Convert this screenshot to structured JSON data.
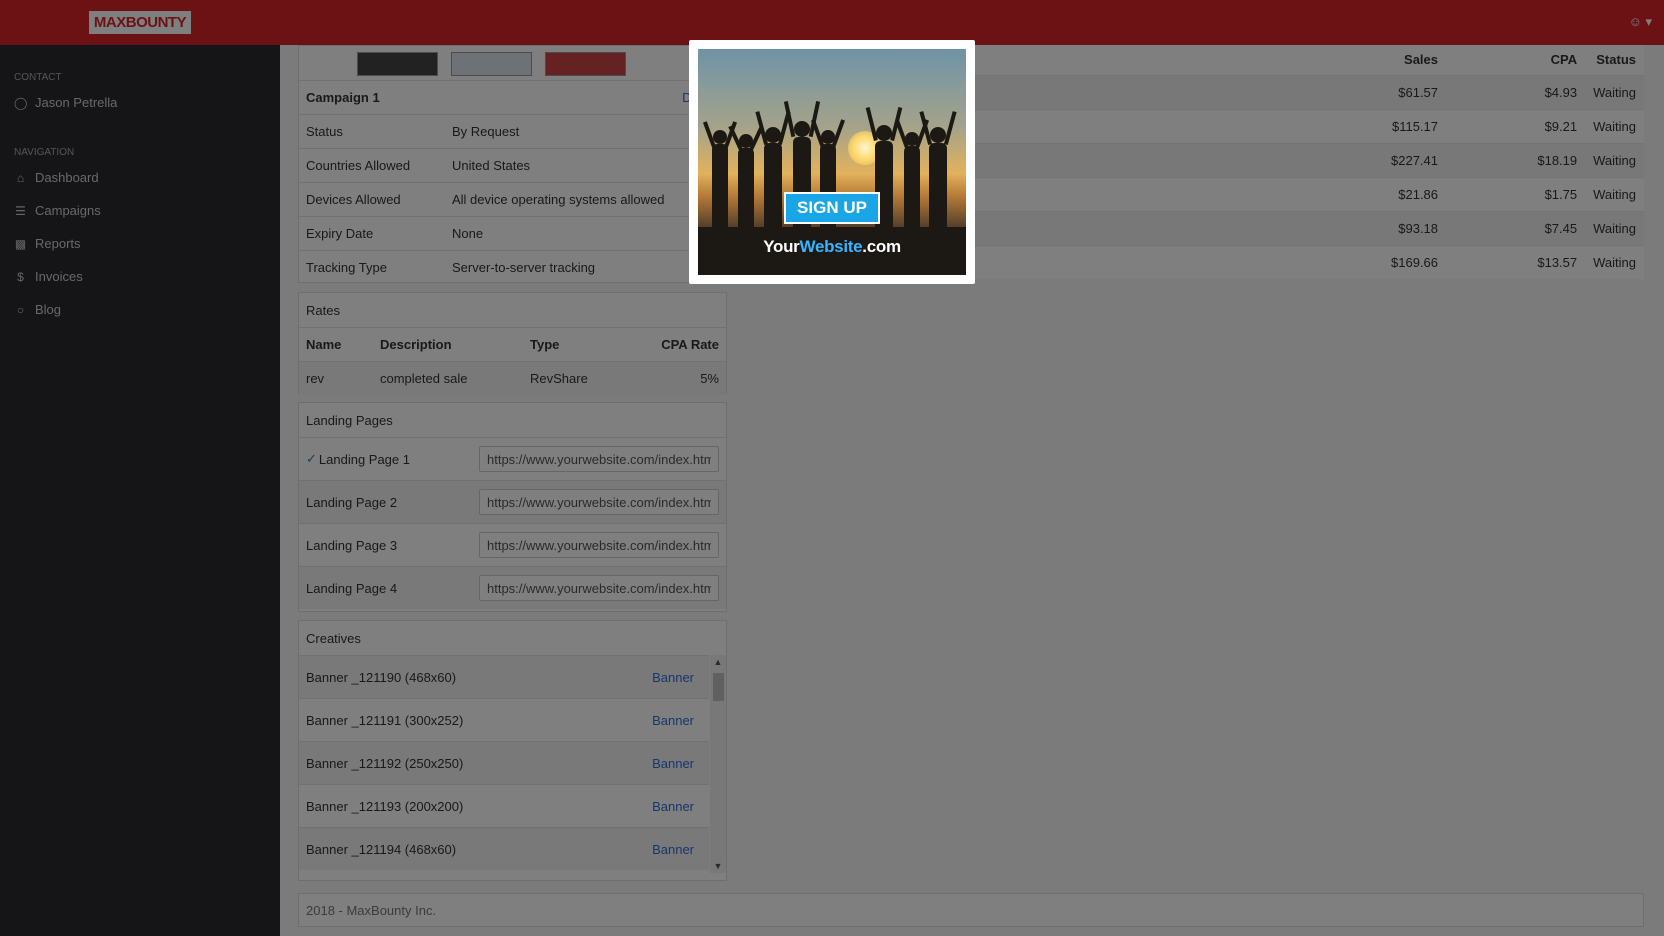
{
  "app": {
    "logo": "MAXBOUNTY"
  },
  "sidebar": {
    "contact_heading": "CONTACT",
    "contact_name": "Jason Petrella",
    "nav_heading": "NAVIGATION",
    "items": [
      {
        "label": "Dashboard",
        "icon": "home-icon"
      },
      {
        "label": "Campaigns",
        "icon": "layers-icon"
      },
      {
        "label": "Reports",
        "icon": "bar-chart-icon"
      },
      {
        "label": "Invoices",
        "icon": "dollar-icon"
      },
      {
        "label": "Blog",
        "icon": "comment-icon"
      }
    ]
  },
  "campaign": {
    "title": "Campaign 1",
    "description_link": "Descri",
    "rows": [
      {
        "key": "Status",
        "value": "By Request"
      },
      {
        "key": "Countries Allowed",
        "value": "United States"
      },
      {
        "key": "Devices Allowed",
        "value": "All device operating systems allowed"
      },
      {
        "key": "Expiry Date",
        "value": "None"
      },
      {
        "key": "Tracking Type",
        "value": "Server-to-server tracking"
      }
    ]
  },
  "rates": {
    "title": "Rates",
    "headers": [
      "Name",
      "Description",
      "Type",
      "CPA Rate"
    ],
    "rows": [
      [
        "rev",
        "completed sale",
        "RevShare",
        "5%"
      ]
    ]
  },
  "landing": {
    "title": "Landing Pages",
    "pages": [
      {
        "label": "Landing Page 1",
        "url": "https://www.yourwebsite.com/index.htm"
      },
      {
        "label": "Landing Page 2",
        "url": "https://www.yourwebsite.com/index.htm"
      },
      {
        "label": "Landing Page 3",
        "url": "https://www.yourwebsite.com/index.htm"
      },
      {
        "label": "Landing Page 4",
        "url": "https://www.yourwebsite.com/index.htm"
      }
    ]
  },
  "creatives": {
    "title": "Creatives",
    "items": [
      {
        "name": "Banner _121190 (468x60)",
        "type": "Banner"
      },
      {
        "name": "Banner _121191 (300x252)",
        "type": "Banner"
      },
      {
        "name": "Banner _121192 (250x250)",
        "type": "Banner"
      },
      {
        "name": "Banner _121193 (200x200)",
        "type": "Banner"
      },
      {
        "name": "Banner _121194 (468x60)",
        "type": "Banner"
      }
    ]
  },
  "stats": {
    "headers": [
      "Sales",
      "CPA",
      "Status"
    ],
    "rows": [
      [
        "$61.57",
        "$4.93",
        "Waiting"
      ],
      [
        "$115.17",
        "$9.21",
        "Waiting"
      ],
      [
        "$227.41",
        "$18.19",
        "Waiting"
      ],
      [
        "$21.86",
        "$1.75",
        "Waiting"
      ],
      [
        "$93.18",
        "$7.45",
        "Waiting"
      ],
      [
        "$169.66",
        "$13.57",
        "Waiting"
      ]
    ]
  },
  "footer": {
    "text": "2018 - MaxBounty Inc."
  },
  "modal": {
    "button": "SIGN UP",
    "brand_a": "Your",
    "brand_b": "Website",
    "brand_c": ".com"
  },
  "colors": {
    "brand_red": "#d9242a",
    "sidebar_bg": "#2a2a2e",
    "link_blue": "#2a6fdb",
    "signup_blue": "#1aa5e6"
  }
}
